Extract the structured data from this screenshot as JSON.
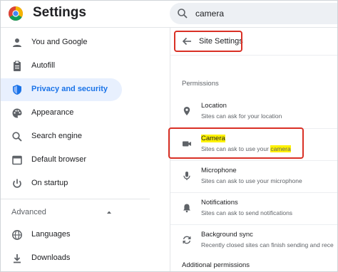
{
  "app": {
    "title": "Settings"
  },
  "search": {
    "value": "camera"
  },
  "sidebar": {
    "items": [
      {
        "label": "You and Google",
        "icon": "person-icon"
      },
      {
        "label": "Autofill",
        "icon": "clipboard-icon"
      },
      {
        "label": "Privacy and security",
        "icon": "shield-icon",
        "active": true
      },
      {
        "label": "Appearance",
        "icon": "palette-icon"
      },
      {
        "label": "Search engine",
        "icon": "search-icon"
      },
      {
        "label": "Default browser",
        "icon": "browser-icon"
      },
      {
        "label": "On startup",
        "icon": "power-icon"
      }
    ],
    "advanced_label": "Advanced",
    "advanced_items": [
      {
        "label": "Languages",
        "icon": "globe-icon"
      },
      {
        "label": "Downloads",
        "icon": "download-icon"
      }
    ]
  },
  "main": {
    "back_title": "Site Settings",
    "permissions_heading": "Permissions",
    "rows": [
      {
        "title": "Location",
        "desc": "Sites can ask for your location",
        "icon": "location-pin-icon"
      },
      {
        "title": "Camera",
        "desc_before": "Sites can ask to use your ",
        "desc_highlight": "camera",
        "icon": "video-camera-icon"
      },
      {
        "title": "Microphone",
        "desc": "Sites can ask to use your microphone",
        "icon": "microphone-icon"
      },
      {
        "title": "Notifications",
        "desc": "Sites can ask to send notifications",
        "icon": "bell-icon"
      },
      {
        "title": "Background sync",
        "desc": "Recently closed sites can finish sending and rece",
        "icon": "sync-icon"
      }
    ],
    "additional_heading": "Additional permissions"
  },
  "colors": {
    "accent": "#1a73e8",
    "active_bg": "#e8f0fe",
    "annotation_red": "#d93025",
    "highlight_yellow": "#fff200"
  }
}
